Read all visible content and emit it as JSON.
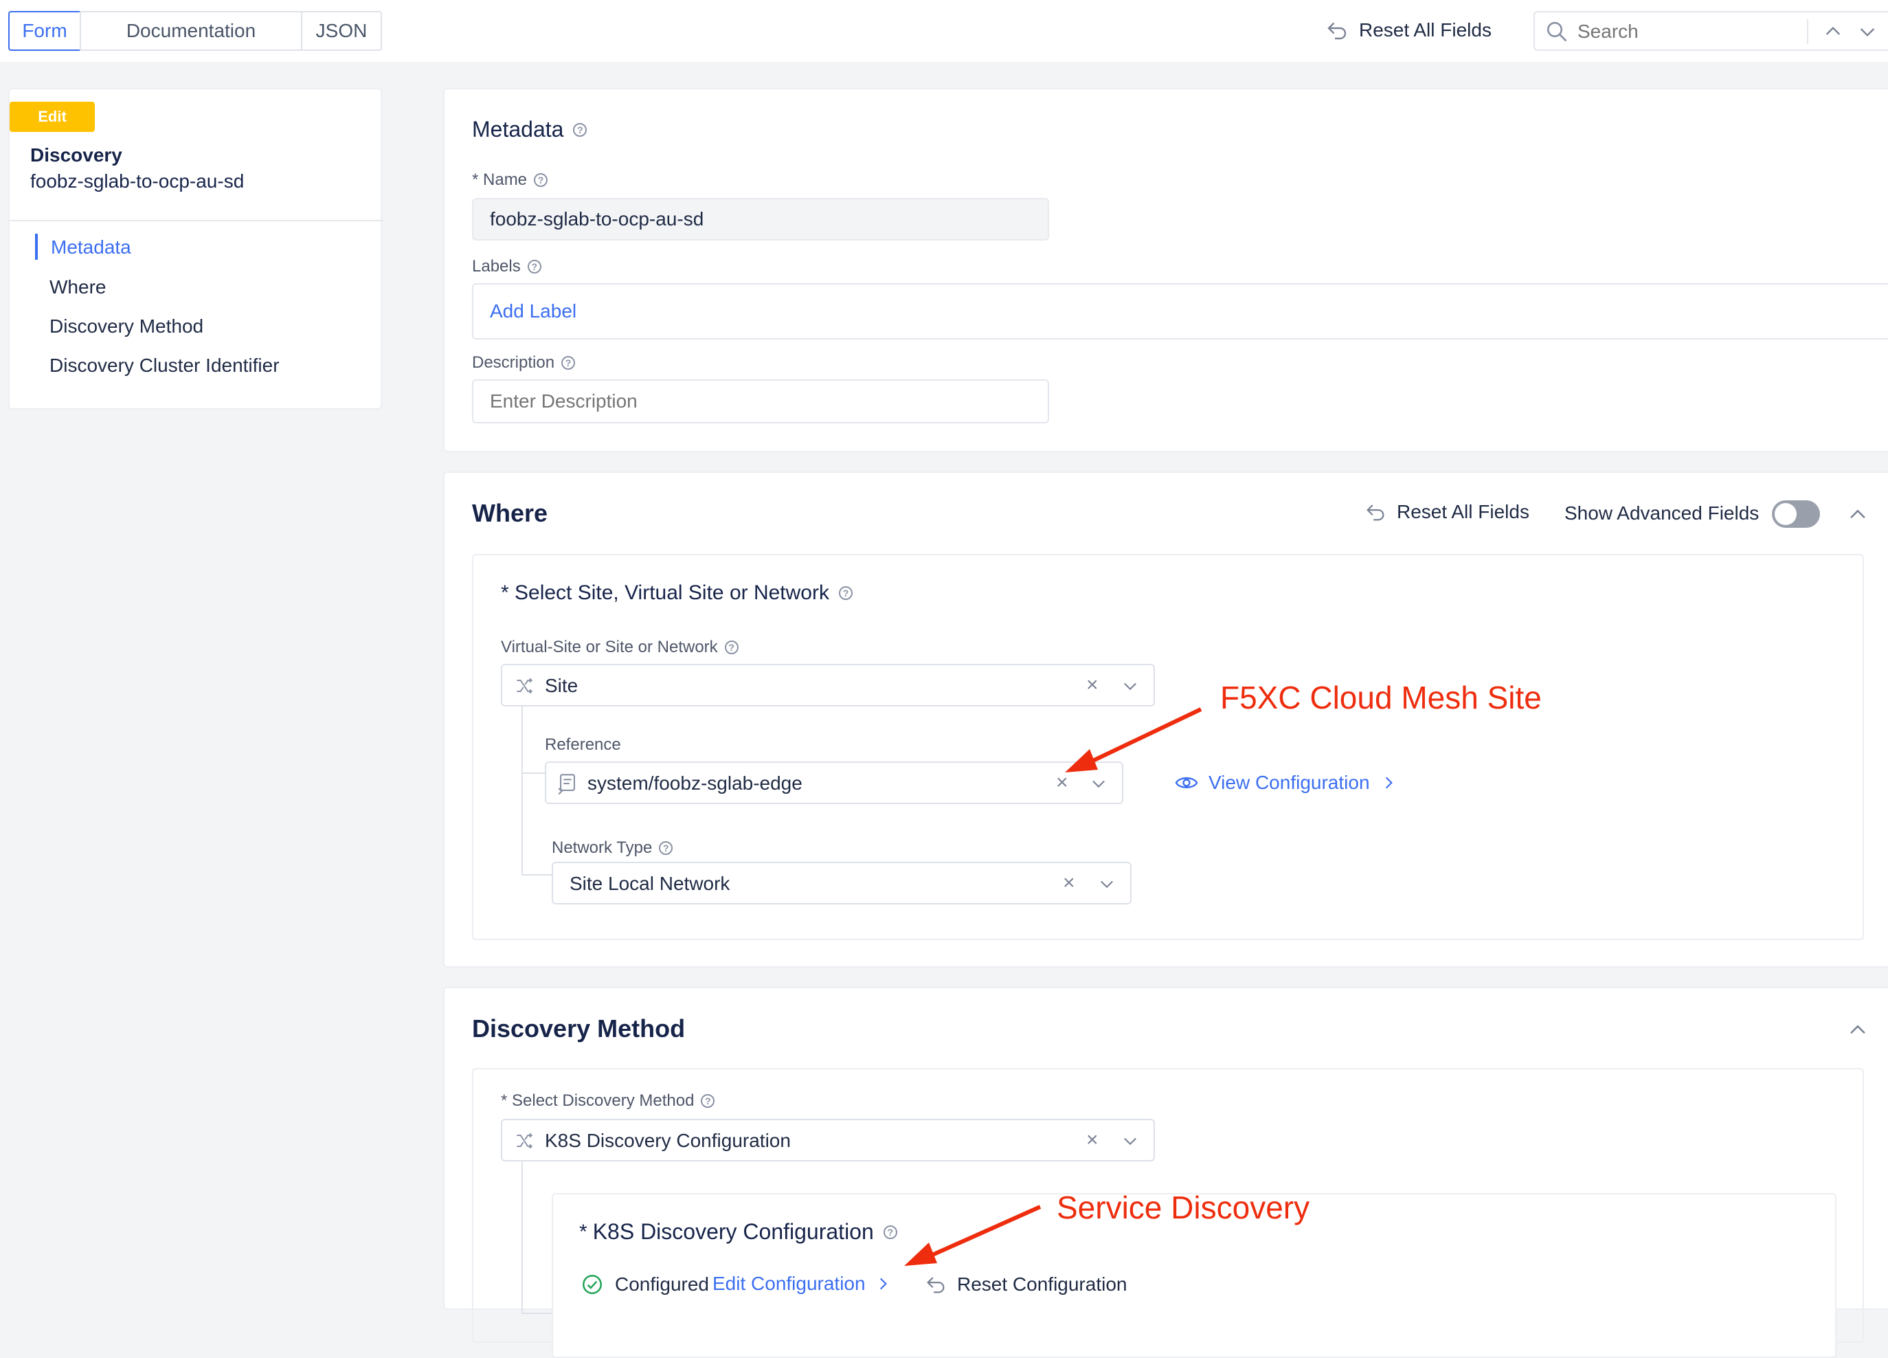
{
  "topbar": {
    "tabs": [
      "Form",
      "Documentation",
      "JSON"
    ],
    "reset_all": "Reset All Fields",
    "search_placeholder": "Search"
  },
  "sidebar": {
    "badge": "Edit",
    "title": "Discovery",
    "subtitle": "foobz-sglab-to-ocp-au-sd",
    "items": [
      "Metadata",
      "Where",
      "Discovery Method",
      "Discovery Cluster Identifier"
    ]
  },
  "metadata": {
    "title": "Metadata",
    "name_label": "* Name",
    "name_value": "foobz-sglab-to-ocp-au-sd",
    "labels_label": "Labels",
    "add_label": "Add Label",
    "description_label": "Description",
    "description_placeholder": "Enter Description"
  },
  "where": {
    "title": "Where",
    "reset_all": "Reset All Fields",
    "show_advanced": "Show Advanced Fields",
    "group_title": "* Select Site, Virtual Site or Network",
    "vsite_label": "Virtual-Site or Site or Network",
    "vsite_value": "Site",
    "reference_label": "Reference",
    "reference_value": "system/foobz-sglab-edge",
    "view_config": "View Configuration",
    "network_type_label": "Network Type",
    "network_type_value": "Site Local Network"
  },
  "discovery": {
    "title": "Discovery Method",
    "method_label": "* Select Discovery Method",
    "method_value": "K8S Discovery Configuration",
    "k8s_title": "K8S Discovery Configuration",
    "k8s_asterisk": "*",
    "status": "Configured",
    "edit_config": "Edit Configuration",
    "reset_config": "Reset Configuration"
  },
  "annotations": {
    "site": "F5XC Cloud Mesh  Site",
    "service": "Service Discovery"
  },
  "colors": {
    "accent": "#3b6ef0",
    "badge": "#ffc200",
    "annotation": "#ee2d0e",
    "success": "#23a55a"
  }
}
